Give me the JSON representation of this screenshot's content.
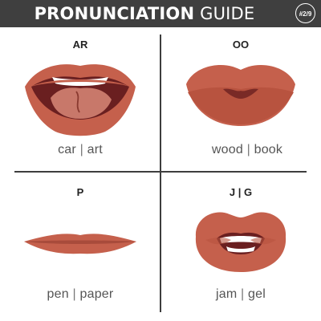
{
  "header": {
    "title_bold": "PRONUNCIATION",
    "title_light": "GUIDE",
    "page_badge": "#2/9"
  },
  "cells": [
    {
      "label": "AR",
      "word_a": "car",
      "separator": "|",
      "word_b": "art"
    },
    {
      "label": "OO",
      "word_a": "wood",
      "separator": "|",
      "word_b": "book"
    },
    {
      "label": "P",
      "word_a": "pen",
      "separator": "|",
      "word_b": "paper"
    },
    {
      "label": "J | G",
      "word_a": "jam",
      "separator": "|",
      "word_b": "gel"
    }
  ],
  "colors": {
    "banner": "#3f3f3f",
    "lip": "#c5604c",
    "lip_dark": "#a84b3b",
    "mouth_inside": "#6a1f20",
    "tongue": "#c8786a",
    "teeth": "#ffffff",
    "divider": "#3e3e3e"
  }
}
